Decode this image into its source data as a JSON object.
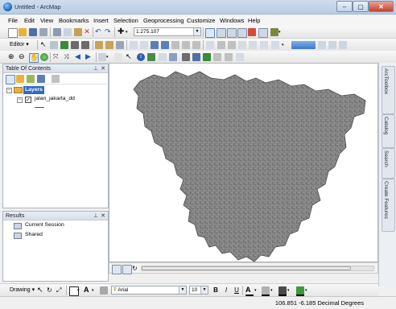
{
  "window": {
    "title": "Untitled - ArcMap",
    "minimize": "–",
    "maximize": "▢",
    "close": "✕"
  },
  "menu": [
    "File",
    "Edit",
    "View",
    "Bookmarks",
    "Insert",
    "Selection",
    "Geoprocessing",
    "Customize",
    "Windows",
    "Help"
  ],
  "toolbar": {
    "scale_value": "1:275.107",
    "editor_label": "Editor ▾"
  },
  "toc": {
    "title": "Table Of Contents",
    "layers_label": "Layers",
    "layer_name": "jalan_jakarta_dd",
    "layer_checked": true
  },
  "results": {
    "title": "Results",
    "items": [
      "Current Session",
      "Shared"
    ]
  },
  "right_dock": {
    "tabs": [
      "ArcToolbox",
      "Catalog",
      "Search",
      "Create Features"
    ]
  },
  "drawing": {
    "label": "Drawing ▾",
    "font_name": "Arial",
    "font_size": "10",
    "bold": "B",
    "italic": "I",
    "underline": "U"
  },
  "status": {
    "coordinates": "106.851  -6.185 Decimal Degrees"
  },
  "colors": {
    "map_fill": "#6e6e6e",
    "map_edge": "#4a4a4a",
    "layers_icon": "#e8b23a",
    "accent_blue": "#3c78c8"
  }
}
